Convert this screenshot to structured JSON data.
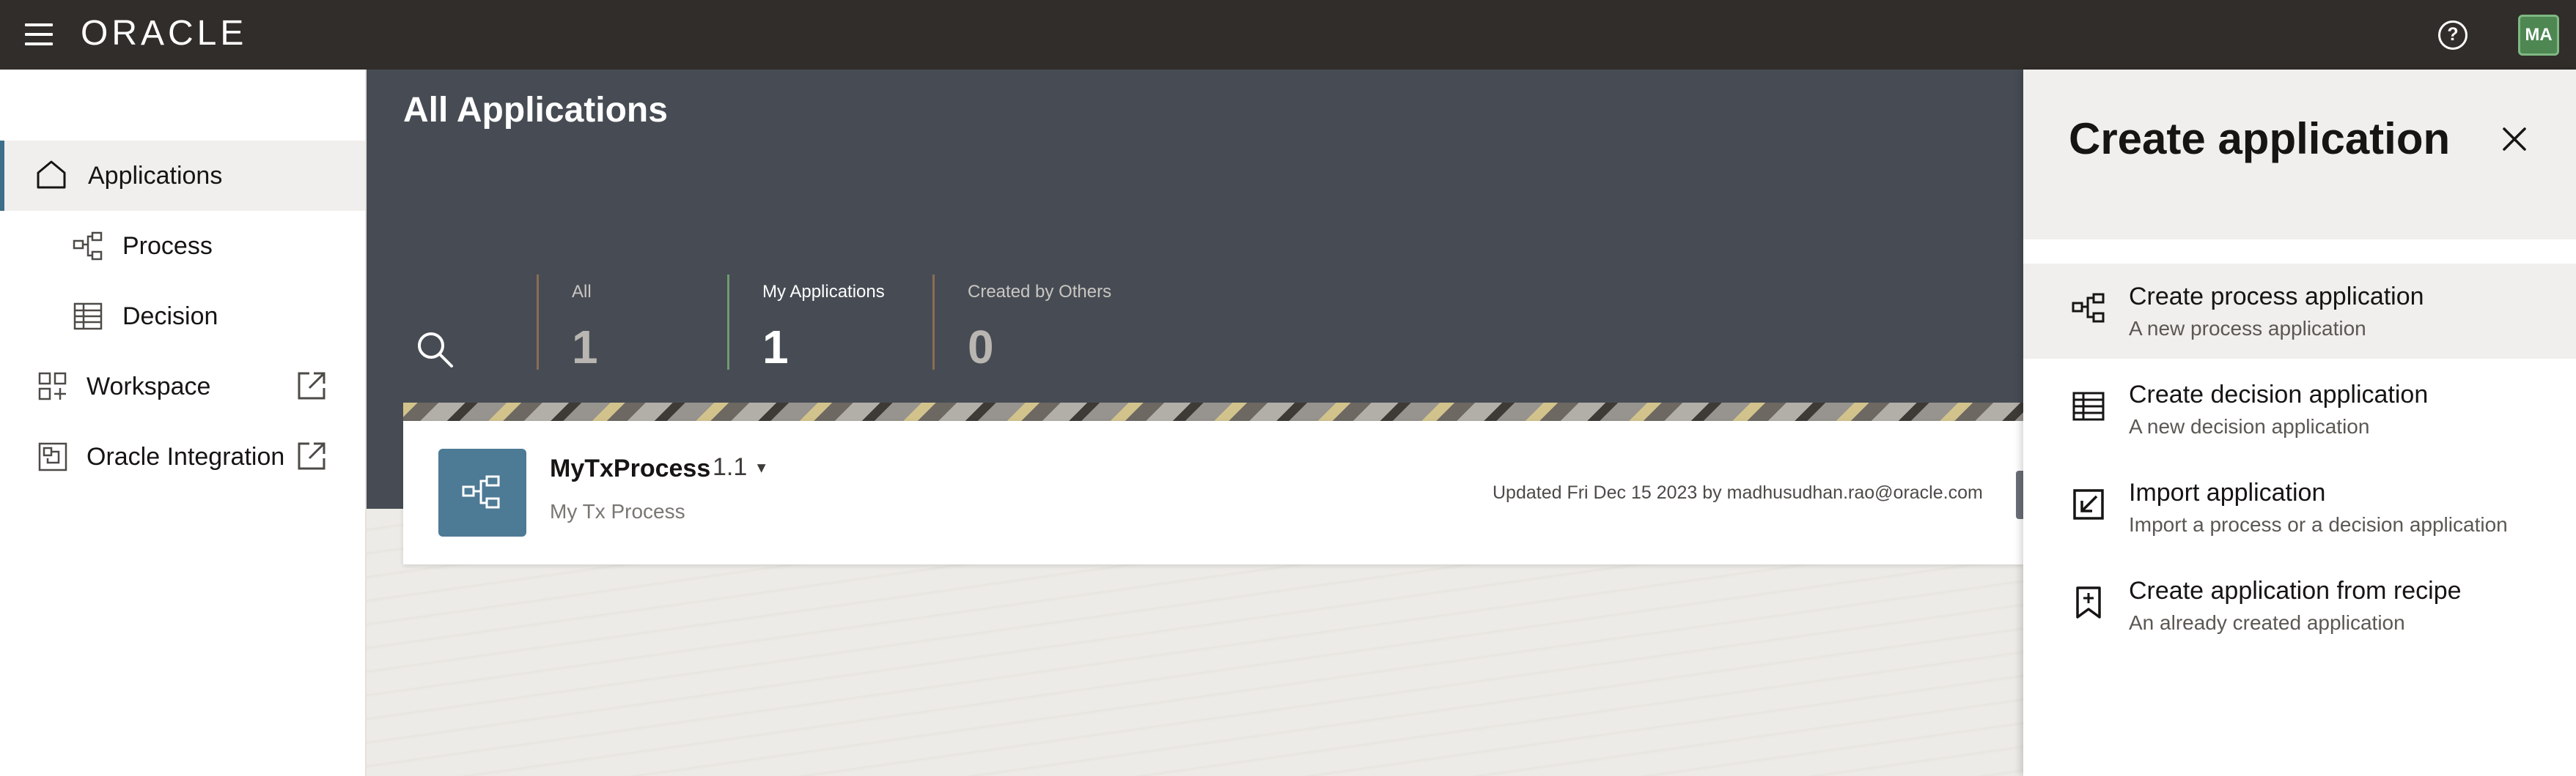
{
  "header": {
    "logo": "ORACLE",
    "help": "?",
    "avatar_initials": "MA"
  },
  "sidebar": {
    "items": [
      {
        "label": "Applications",
        "icon": "home-icon",
        "active": true
      },
      {
        "label": "Process",
        "icon": "process-icon"
      },
      {
        "label": "Decision",
        "icon": "decision-table-icon"
      },
      {
        "label": "Workspace",
        "icon": "workspace-icon",
        "external": true
      },
      {
        "label": "Oracle Integration",
        "icon": "integration-icon",
        "external": true
      }
    ]
  },
  "main": {
    "title": "All Applications",
    "filters": [
      {
        "label": "All",
        "count": "1"
      },
      {
        "label": "My Applications",
        "count": "1",
        "selected": true
      },
      {
        "label": "Created by Others",
        "count": "0"
      }
    ],
    "card": {
      "name": "MyTxProcess",
      "version": "1.1",
      "description": "My Tx Process",
      "updated": "Updated Fri Dec 15 2023 by madhusudhan.rao@oracle.com"
    }
  },
  "drawer": {
    "title": "Create application",
    "options": [
      {
        "title": "Create process application",
        "subtitle": "A new process application",
        "icon": "process-icon"
      },
      {
        "title": "Create decision application",
        "subtitle": "A new decision application",
        "icon": "decision-table-icon"
      },
      {
        "title": "Import application",
        "subtitle": "Import a process or a decision application",
        "icon": "import-icon"
      },
      {
        "title": "Create application from recipe",
        "subtitle": "An already created application",
        "icon": "recipe-bookmark-icon"
      }
    ]
  },
  "colors": {
    "topbar": "#312d2a",
    "banner": "#474c54",
    "accent": "#3d6e8a",
    "app_icon_bg": "#4d7a95",
    "avatar_bg": "#4e8752",
    "selected_filter_bar": "#6e9c6e",
    "filter_bar": "#8a6d52"
  }
}
